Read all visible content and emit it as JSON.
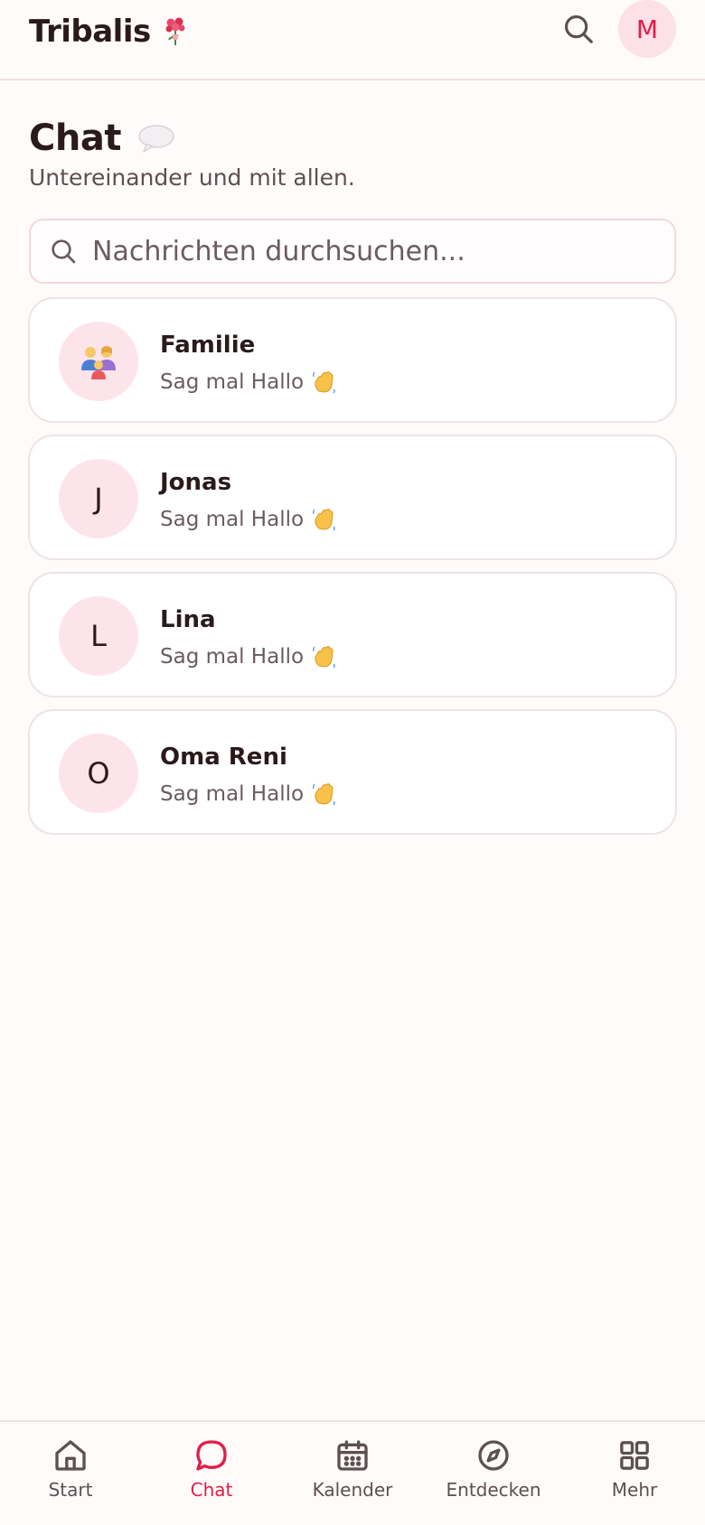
{
  "header": {
    "brand": "Tribalis",
    "brand_icon": "flower-bouquet-icon",
    "avatar_initial": "M"
  },
  "page": {
    "title": "Chat",
    "title_icon": "speech-bubble-icon",
    "subtitle": "Untereinander und mit allen."
  },
  "search": {
    "placeholder": "Nachrichten durchsuchen...",
    "value": ""
  },
  "chats": [
    {
      "name": "Familie",
      "avatar": "",
      "avatar_icon": "family-icon",
      "preview": "Sag mal Hallo"
    },
    {
      "name": "Jonas",
      "avatar": "J",
      "preview": "Sag mal Hallo"
    },
    {
      "name": "Lina",
      "avatar": "L",
      "preview": "Sag mal Hallo"
    },
    {
      "name": "Oma Reni",
      "avatar": "O",
      "preview": "Sag mal Hallo"
    }
  ],
  "nav": [
    {
      "label": "Start",
      "icon": "home-icon",
      "active": false
    },
    {
      "label": "Chat",
      "icon": "chat-icon",
      "active": true
    },
    {
      "label": "Kalender",
      "icon": "calendar-icon",
      "active": false
    },
    {
      "label": "Entdecken",
      "icon": "compass-icon",
      "active": false
    },
    {
      "label": "Mehr",
      "icon": "grid-icon",
      "active": false
    }
  ],
  "colors": {
    "accent": "#e11d48",
    "avatar_bg": "#fde4ea",
    "background": "#fffbfa",
    "text": "#2a1a1c",
    "muted": "#6b5b5e"
  }
}
